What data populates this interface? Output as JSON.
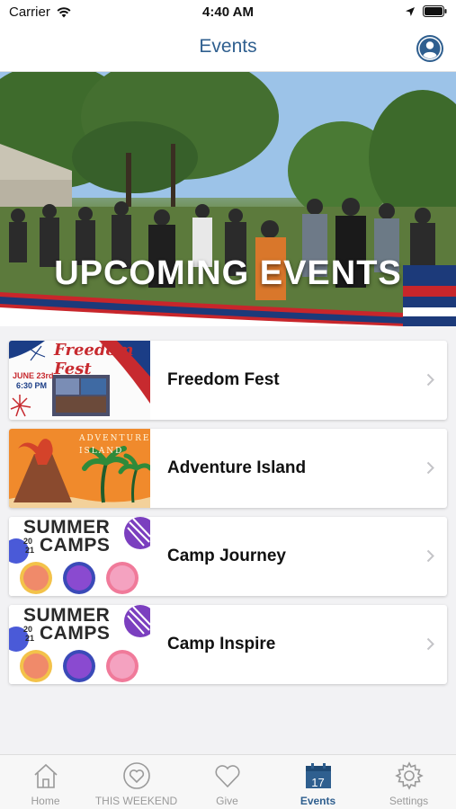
{
  "status_bar": {
    "carrier": "Carrier",
    "time": "4:40 AM",
    "icons": [
      "wifi-icon",
      "location-arrow-icon",
      "battery-icon"
    ]
  },
  "nav": {
    "title": "Events",
    "profile_icon": "person-circle-icon"
  },
  "hero": {
    "title": "UPCOMING EVENTS"
  },
  "events": [
    {
      "name": "Freedom Fest",
      "thumb": {
        "type": "freedom-fest",
        "title": "Freedom Fest",
        "date": "JUNE 23rd",
        "time": "6:30 PM"
      }
    },
    {
      "name": "Adventure Island",
      "thumb": {
        "type": "adventure-island",
        "title": "ADVENTURE ISLAND"
      }
    },
    {
      "name": "Camp Journey",
      "thumb": {
        "type": "summer-camps",
        "title_line1": "SUMMER",
        "title_line2": "CAMPS",
        "year_top": "20",
        "year_bottom": "21"
      }
    },
    {
      "name": "Camp Inspire",
      "thumb": {
        "type": "summer-camps",
        "title_line1": "SUMMER",
        "title_line2": "CAMPS",
        "year_top": "20",
        "year_bottom": "21"
      }
    }
  ],
  "tabs": [
    {
      "label": "Home",
      "icon": "home-icon",
      "active": false
    },
    {
      "label": "THIS WEEKEND",
      "icon": "heart-circle-icon",
      "active": false
    },
    {
      "label": "Give",
      "icon": "heart-icon",
      "active": false
    },
    {
      "label": "Events",
      "icon": "calendar-icon",
      "active": true,
      "icon_text": "17"
    },
    {
      "label": "Settings",
      "icon": "gear-icon",
      "active": false
    }
  ],
  "colors": {
    "accent": "#2f5f8f",
    "inactive": "#9a9a9a",
    "background": "#f2f2f4"
  }
}
